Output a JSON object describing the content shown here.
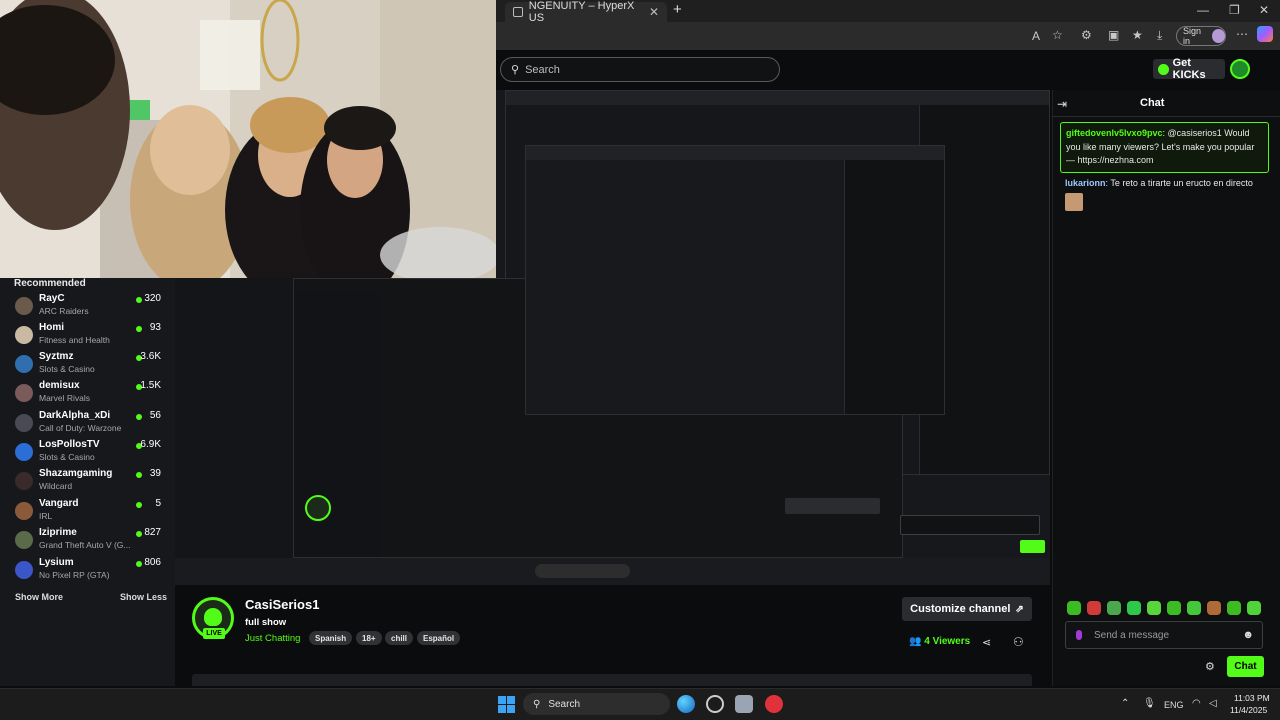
{
  "browser": {
    "tab_title": "NGENUITY – HyperX US",
    "new_tab_label": "+",
    "sign_in_label": "Sign in"
  },
  "kick": {
    "search_placeholder": "Search",
    "get_kicks_label": "Get KICKs"
  },
  "sidebar": {
    "heading": "Recommended",
    "items": [
      {
        "name": "RayC",
        "category": "ARC Raiders",
        "viewers": "320",
        "avatar_color": "#6b5a4b"
      },
      {
        "name": "Homi",
        "category": "Fitness and Health",
        "viewers": "93",
        "avatar_color": "#c9b9a3"
      },
      {
        "name": "Syztmz",
        "category": "Slots & Casino",
        "viewers": "3.6K",
        "avatar_color": "#2f6fb0"
      },
      {
        "name": "demisux",
        "category": "Marvel Rivals",
        "viewers": "1.5K",
        "avatar_color": "#7a5a5a"
      },
      {
        "name": "DarkAlpha_xDi",
        "category": "Call of Duty: Warzone",
        "viewers": "56",
        "avatar_color": "#4a4a56"
      },
      {
        "name": "LosPollosTV",
        "category": "Slots & Casino",
        "viewers": "6.9K",
        "avatar_color": "#2b6fd6"
      },
      {
        "name": "Shazamgaming",
        "category": "Wildcard",
        "viewers": "39",
        "avatar_color": "#3a2a2a"
      },
      {
        "name": "Vangard",
        "category": "IRL",
        "viewers": "5",
        "avatar_color": "#8b5a3a"
      },
      {
        "name": "Iziprime",
        "category": "Grand Theft Auto V (G...",
        "viewers": "827",
        "avatar_color": "#5a6b4a"
      },
      {
        "name": "Lysium",
        "category": "No Pixel RP (GTA)",
        "viewers": "806",
        "avatar_color": "#3a56c8"
      }
    ],
    "show_more": "Show More",
    "show_less": "Show Less"
  },
  "channel": {
    "name": "CasiSerios1",
    "title": "full show",
    "category": "Just Chatting",
    "live_label": "LIVE",
    "tags": [
      "Spanish",
      "18+",
      "chill",
      "Español"
    ],
    "customize_label": "Customize channel",
    "viewers_count": "4",
    "viewers_label": "Viewers"
  },
  "chat": {
    "title": "Chat",
    "messages": [
      {
        "user": "giftedovenlv5lvxo9pvc",
        "text": ": @casiserios1 Would you like many viewers? Let's make you popular — https://nezhna.com"
      },
      {
        "user": "lukarionn",
        "text": ": Te reto a tirarte un eructo en directo"
      }
    ],
    "input_placeholder": "Send a message",
    "send_label": "Chat"
  },
  "taskbar": {
    "search_label": "Search",
    "lang": "ENG",
    "time": "11:03 PM",
    "date": "11/4/2025"
  },
  "colors": {
    "accent": "#53fc18",
    "background": "#0b0c0e",
    "panel": "#17181b"
  }
}
